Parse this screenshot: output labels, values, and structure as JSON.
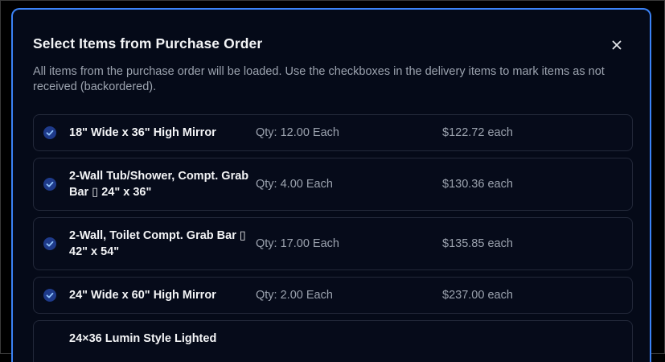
{
  "modal": {
    "title": "Select Items from Purchase Order",
    "close_icon": "close-icon",
    "description": "All items from the purchase order will be loaded. Use the checkboxes in the delivery items to mark items as not received (backordered)."
  },
  "colors": {
    "modal_background": "#050a18",
    "modal_border": "#3b82f6",
    "check_fill": "#1e3a8a",
    "check_mark": "#93c5fd",
    "text_primary": "#f3f4f6",
    "text_secondary": "#9ca3af"
  },
  "items": [
    {
      "name_line1": "18\" Wide x 36\" High Mirror",
      "name_line2": "",
      "qty": "Qty: 12.00 Each",
      "price": "$122.72 each",
      "checked": true
    },
    {
      "name_line1": "2-Wall Tub/Shower, Compt. Grab",
      "name_line2": "Bar ▯ 24\" x 36\"",
      "qty": "Qty: 4.00 Each",
      "price": "$130.36 each",
      "checked": true
    },
    {
      "name_line1": "2-Wall, Toilet Compt. Grab Bar ▯",
      "name_line2": "42\" x 54\"",
      "qty": "Qty: 17.00 Each",
      "price": "$135.85 each",
      "checked": true
    },
    {
      "name_line1": "24\" Wide x 60\" High Mirror",
      "name_line2": "",
      "qty": "Qty: 2.00 Each",
      "price": "$237.00 each",
      "checked": true
    },
    {
      "name_line1": "24×36 Lumin Style Lighted",
      "name_line2": "",
      "qty": "",
      "price": "",
      "checked": false
    }
  ]
}
